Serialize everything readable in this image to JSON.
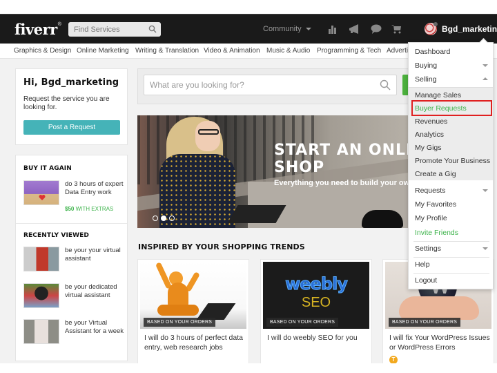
{
  "header": {
    "logo": "fiverr",
    "logo_mark": "®",
    "find_placeholder": "Find Services",
    "community_label": "Community",
    "icons": [
      "analytics-icon",
      "megaphone-icon",
      "chat-icon",
      "cart-icon"
    ],
    "username": "Bgd_marketing"
  },
  "categories": [
    "Graphics & Design",
    "Online Marketing",
    "Writing & Translation",
    "Video & Animation",
    "Music & Audio",
    "Programming & Tech",
    "Advertising"
  ],
  "welcome": {
    "greeting": "Hi, Bgd_marketing",
    "text": "Request the service you are looking for.",
    "button": "Post a Request"
  },
  "buy_again": {
    "title": "BUY IT AGAIN",
    "item": {
      "title": "do 3 hours of expert Data Entry work",
      "price": "$50",
      "extras": "WITH EXTRAS"
    }
  },
  "recently_viewed": {
    "title": "RECENTLY VIEWED",
    "items": [
      {
        "title": "be your your virtual assistant"
      },
      {
        "title": "be your dedicated virtual assistant"
      },
      {
        "title": "be your Virtual Assistant for a week"
      }
    ]
  },
  "search": {
    "placeholder": "What are you looking for?"
  },
  "hero": {
    "title_line1": "START AN ONLINE",
    "title_line2": "SHOP",
    "subtitle": "Everything you need to build your own",
    "slides": 3,
    "active_slide": 2
  },
  "trends": {
    "title": "INSPIRED BY YOUR SHOPPING TRENDS",
    "badge": "BASED ON YOUR ORDERS",
    "gigs": [
      {
        "title": "I will do 3 hours of perfect data entry, web research jobs"
      },
      {
        "title": "I will do weebly SEO for you",
        "image_text_1": "weebly",
        "image_text_2": "SEO"
      },
      {
        "title": "I will fix Your WordPress Issues or WordPress Errors",
        "seller_initial": "T"
      }
    ]
  },
  "user_menu": {
    "items": [
      {
        "label": "Dashboard"
      },
      {
        "label": "Buying",
        "arrow": "down"
      },
      {
        "label": "Selling",
        "arrow": "up"
      }
    ],
    "selling_submenu": [
      {
        "label": "Manage Sales"
      },
      {
        "label": "Buyer Requests",
        "highlighted": true
      },
      {
        "label": "Revenues"
      },
      {
        "label": "Analytics"
      },
      {
        "label": "My Gigs"
      },
      {
        "label": "Promote Your Business"
      },
      {
        "label": "Create a Gig"
      }
    ],
    "more_items": [
      {
        "label": "Requests",
        "arrow": "down"
      },
      {
        "label": "My Favorites"
      },
      {
        "label": "My Profile"
      },
      {
        "label": "Invite Friends"
      },
      {
        "label": "Settings",
        "arrow": "down"
      },
      {
        "label": "Help"
      },
      {
        "label": "Logout"
      }
    ]
  },
  "colors": {
    "accent_green": "#3cb34a",
    "button_teal": "#45b3b8",
    "header_bg": "#1a1a1a",
    "highlight_red": "#e02020"
  }
}
